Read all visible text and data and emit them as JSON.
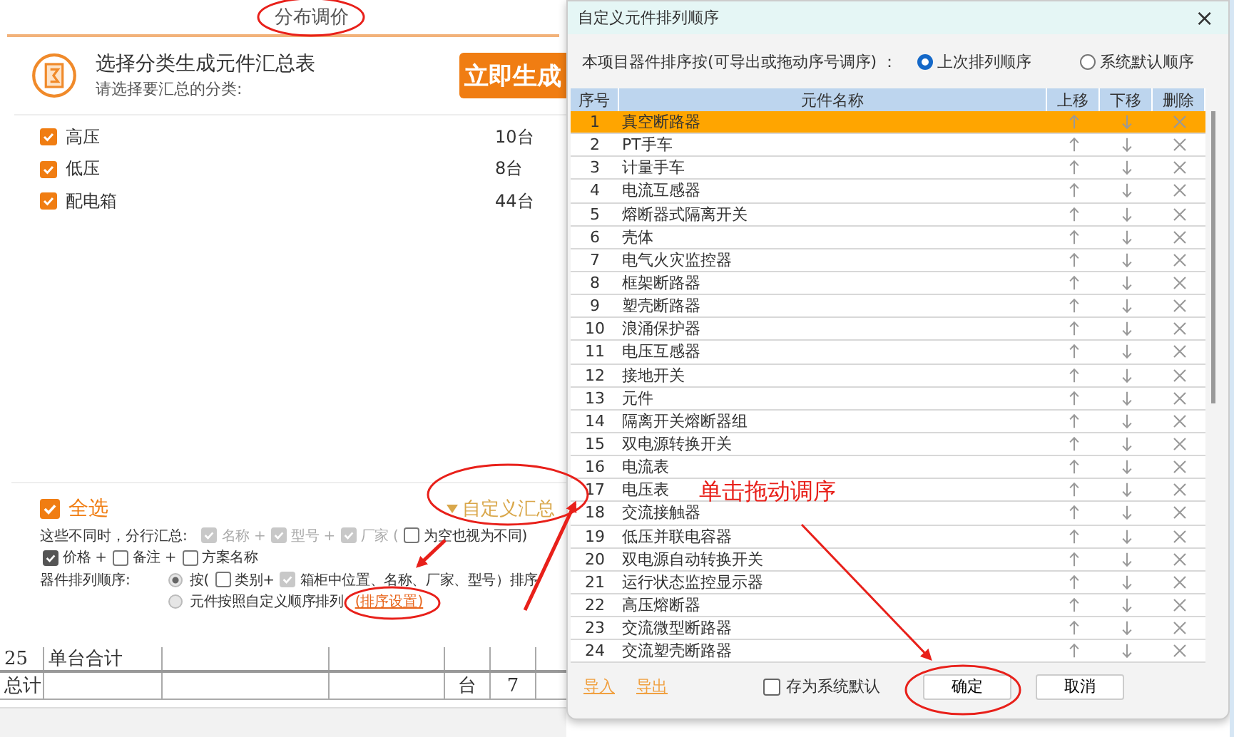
{
  "header": {
    "tab": "分布调价"
  },
  "summary": {
    "title": "选择分类生成元件汇总表",
    "subtitle": "请选择要汇总的分类:",
    "generate_button": "立即生成"
  },
  "categories": [
    {
      "label": "高压",
      "count": "10台",
      "checked": true
    },
    {
      "label": "低压",
      "count": "8台",
      "checked": true
    },
    {
      "label": "配电箱",
      "count": "44台",
      "checked": true
    }
  ],
  "select_all": {
    "label": "全选",
    "checked": true
  },
  "custom_summary": "自定义汇总",
  "group_by": {
    "label": "这些不同时，分行汇总:",
    "lines": [
      [
        {
          "label": "名称 +",
          "checked": true,
          "disabled": true
        },
        {
          "label": "型号 +",
          "checked": true,
          "disabled": true
        },
        {
          "label": "厂家 (",
          "checked": true,
          "disabled": true
        },
        {
          "label": "为空也视为不同)",
          "checked": false,
          "disabled": false
        }
      ],
      [
        {
          "label": "价格 +",
          "checked": true,
          "disabled": false
        },
        {
          "label": "备注 +",
          "checked": false,
          "disabled": false
        },
        {
          "label": "方案名称",
          "checked": false,
          "disabled": false
        }
      ]
    ]
  },
  "order": {
    "label": "器件排列顺序:",
    "radios": [
      {
        "kind": "fields",
        "selected": true,
        "prefix": "按(",
        "options": [
          {
            "label": "类别+",
            "checked": false,
            "disabled": false
          },
          {
            "label": "箱柜中位置、名称、厂家、型号）排序",
            "checked": true,
            "disabled": true
          }
        ]
      },
      {
        "kind": "custom",
        "selected": false,
        "label": "元件按照自定义顺序排列",
        "link": "(排序设置)"
      }
    ]
  },
  "sheet": {
    "rows": [
      {
        "index": "25",
        "name": "单台合计"
      },
      {
        "index": "总计",
        "unit": "台",
        "qty": "7"
      }
    ]
  },
  "dialog": {
    "title": "自定义元件排列顺序",
    "close": "×",
    "sort_label": "本项目器件排序按(可导出或拖动序号调序) ：",
    "sort_options": [
      {
        "label": "上次排列顺序",
        "selected": true
      },
      {
        "label": "系统默认顺序",
        "selected": false
      }
    ],
    "columns": [
      "序号",
      "元件名称",
      "上移",
      "下移",
      "删除"
    ],
    "rows": [
      {
        "index": "1",
        "name": "真空断路器",
        "selected": true
      },
      {
        "index": "2",
        "name": "PT手车",
        "selected": false
      },
      {
        "index": "3",
        "name": "计量手车",
        "selected": false
      },
      {
        "index": "4",
        "name": "电流互感器",
        "selected": false
      },
      {
        "index": "5",
        "name": "熔断器式隔离开关",
        "selected": false
      },
      {
        "index": "6",
        "name": "壳体",
        "selected": false
      },
      {
        "index": "7",
        "name": "电气火灾监控器",
        "selected": false
      },
      {
        "index": "8",
        "name": "框架断路器",
        "selected": false
      },
      {
        "index": "9",
        "name": "塑壳断路器",
        "selected": false
      },
      {
        "index": "10",
        "name": "浪涌保护器",
        "selected": false
      },
      {
        "index": "11",
        "name": "电压互感器",
        "selected": false
      },
      {
        "index": "12",
        "name": "接地开关",
        "selected": false
      },
      {
        "index": "13",
        "name": "元件",
        "selected": false
      },
      {
        "index": "14",
        "name": "隔离开关熔断器组",
        "selected": false
      },
      {
        "index": "15",
        "name": "双电源转换开关",
        "selected": false
      },
      {
        "index": "16",
        "name": "电流表",
        "selected": false
      },
      {
        "index": "17",
        "name": "电压表",
        "selected": false
      },
      {
        "index": "18",
        "name": "交流接触器",
        "selected": false
      },
      {
        "index": "19",
        "name": "低压并联电容器",
        "selected": false
      },
      {
        "index": "20",
        "name": "双电源自动转换开关",
        "selected": false
      },
      {
        "index": "21",
        "name": "运行状态监控显示器",
        "selected": false
      },
      {
        "index": "22",
        "name": "高压熔断器",
        "selected": false
      },
      {
        "index": "23",
        "name": "交流微型断路器",
        "selected": false
      },
      {
        "index": "24",
        "name": "交流塑壳断路器",
        "selected": false
      }
    ],
    "import": "导入",
    "export": "导出",
    "save_default": {
      "label": "存为系统默认",
      "checked": false
    },
    "ok": "确定",
    "cancel": "取消"
  },
  "annotation": {
    "text": "单击拖动调序"
  }
}
